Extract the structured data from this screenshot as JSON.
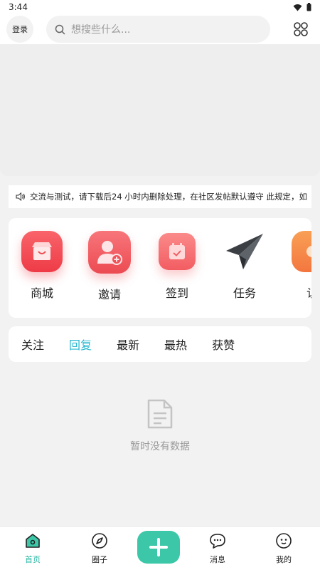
{
  "status_bar": {
    "time": "3:44"
  },
  "header": {
    "login_label": "登录",
    "search_placeholder": "想搜些什么..."
  },
  "notice": {
    "text": "交流与测试，请下载后24 小时内删除处理，在社区发帖默认遵守 此规定，如"
  },
  "shortcuts": [
    {
      "label": "商城",
      "icon": "store-icon",
      "color": "#f4525a"
    },
    {
      "label": "邀请",
      "icon": "invite-user-icon",
      "color": "#f25b60"
    },
    {
      "label": "签到",
      "icon": "calendar-check-icon",
      "color": "#f66a6a"
    },
    {
      "label": "任务",
      "icon": "paper-plane-icon",
      "color": "#555a5f"
    },
    {
      "label": "认",
      "icon": "certification-icon",
      "color": "#f6884a"
    }
  ],
  "tabs": [
    {
      "label": "关注",
      "active": false
    },
    {
      "label": "回复",
      "active": true
    },
    {
      "label": "最新",
      "active": false
    },
    {
      "label": "最热",
      "active": false
    },
    {
      "label": "获赞",
      "active": false
    }
  ],
  "empty_state": {
    "text": "暂时没有数据"
  },
  "bottom_nav": [
    {
      "label": "首页",
      "icon": "home-icon",
      "active": true
    },
    {
      "label": "圈子",
      "icon": "compass-icon",
      "active": false
    },
    {
      "label": "消息",
      "icon": "message-icon",
      "active": false
    },
    {
      "label": "我的",
      "icon": "profile-icon",
      "active": false
    }
  ],
  "colors": {
    "accent_tab": "#2bb8d1",
    "accent_nav": "#3cc8a8"
  }
}
